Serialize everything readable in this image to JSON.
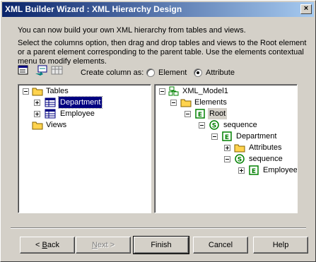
{
  "window": {
    "title": "XML Builder Wizard : XML Hierarchy Design",
    "close_glyph": "×"
  },
  "description": {
    "line1": "You can now build your own XML hierarchy from tables and views.",
    "line2": "Select the columns option, then drag and drop tables and views to the Root element",
    "line3": "or a parent element corresponding to the parent table.  Use the elements contextual",
    "line4": "menu to modify elements."
  },
  "toolbar": {
    "icons": [
      "properties-icon",
      "add-child-icon",
      "columns-icon"
    ]
  },
  "create_column": {
    "label": "Create column as:",
    "options": [
      {
        "label": "Element",
        "selected": false
      },
      {
        "label": "Attribute",
        "selected": true
      }
    ]
  },
  "left_tree": {
    "items": [
      {
        "label": "Tables",
        "icon": "folder-icon",
        "expander": "minus",
        "selected": false
      },
      {
        "label": "Department",
        "icon": "table-icon",
        "expander": "plus",
        "selected": true
      },
      {
        "label": "Employee",
        "icon": "table-icon",
        "expander": "plus",
        "selected": false
      },
      {
        "label": "Views",
        "icon": "folder-icon",
        "expander": "none",
        "selected": false
      }
    ]
  },
  "right_tree": {
    "items": [
      {
        "label": "XML_Model1",
        "icon": "xml-model-icon",
        "expander": "minus"
      },
      {
        "label": "Elements",
        "icon": "folder-icon",
        "expander": "minus"
      },
      {
        "label": "Root",
        "icon": "element-icon",
        "expander": "minus",
        "highlighted": true
      },
      {
        "label": "sequence",
        "icon": "sequence-icon",
        "expander": "minus"
      },
      {
        "label": "Department",
        "icon": "element-icon",
        "expander": "minus"
      },
      {
        "label": "Attributes",
        "icon": "folder-icon",
        "expander": "plus"
      },
      {
        "label": "sequence",
        "icon": "sequence-icon",
        "expander": "minus"
      },
      {
        "label": "Employee",
        "icon": "element-icon",
        "expander": "plus"
      }
    ]
  },
  "buttons": {
    "back": {
      "mnemonic": "B",
      "rest": "ack",
      "prefix": "< ",
      "enabled": true
    },
    "next": {
      "mnemonic": "N",
      "rest": "ext >",
      "enabled": false
    },
    "finish": "Finish",
    "cancel": "Cancel",
    "help": "Help"
  },
  "colors": {
    "title_start": "#0a246a",
    "title_end": "#a6caf0",
    "selection": "#000080",
    "folder": "#ffd34e"
  }
}
